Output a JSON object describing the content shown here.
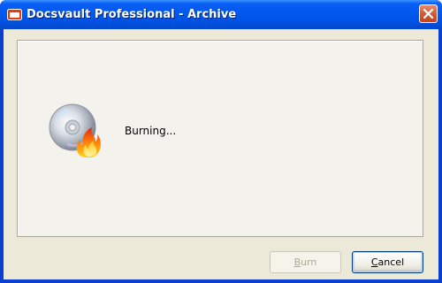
{
  "window": {
    "title": "Docsvault Professional - Archive",
    "close_icon": "close-icon"
  },
  "content": {
    "status": "Burning...",
    "icon": "cd-burning-icon"
  },
  "buttons": {
    "burn": {
      "accel": "B",
      "rest": "urn",
      "enabled": false
    },
    "cancel": {
      "accel": "C",
      "rest": "ancel",
      "enabled": true
    }
  },
  "colors": {
    "titlebar": "#0058ee",
    "client_bg": "#ece9d8",
    "close_button": "#d45a35"
  }
}
